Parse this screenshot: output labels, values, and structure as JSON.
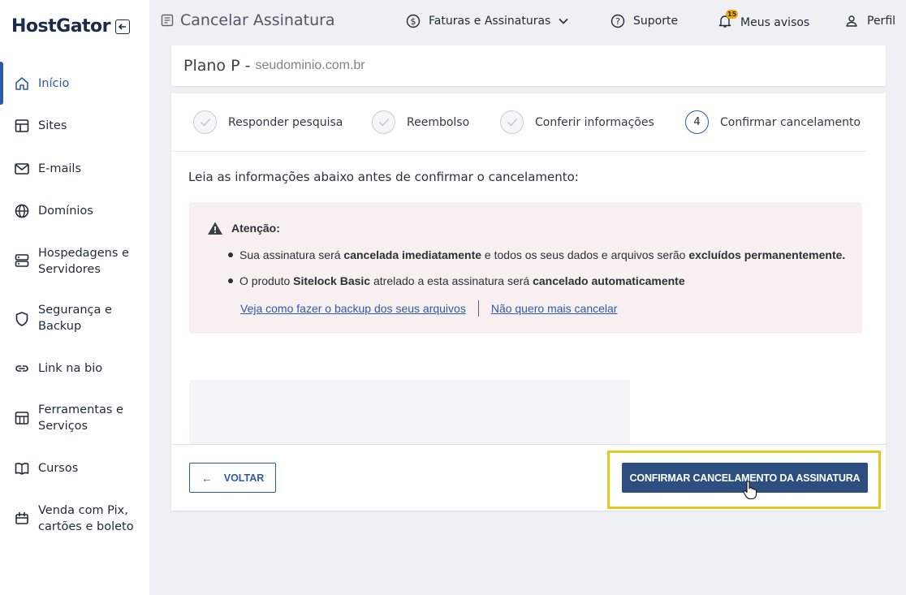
{
  "brand": {
    "logo_text": "HostGator",
    "accent": "#2e5aa8",
    "highlight": "#e8c81e"
  },
  "sidebar": {
    "items": [
      {
        "label": "Início",
        "icon": "home-icon",
        "active": true
      },
      {
        "label": "Sites",
        "icon": "sites-icon"
      },
      {
        "label": "E-mails",
        "icon": "mail-icon"
      },
      {
        "label": "Domínios",
        "icon": "globe-icon"
      },
      {
        "label": "Hospedagens e Servidores",
        "icon": "server-icon"
      },
      {
        "label": "Segurança e Backup",
        "icon": "shield-icon"
      },
      {
        "label": "Link na bio",
        "icon": "link-icon"
      },
      {
        "label": "Ferramentas e Serviços",
        "icon": "tools-icon"
      },
      {
        "label": "Cursos",
        "icon": "book-icon"
      },
      {
        "label": "Venda com Pix, cartões e boleto",
        "icon": "payment-icon"
      }
    ]
  },
  "topbar": {
    "title": "Cancelar Assinatura",
    "invoices_label": "Faturas e Assinaturas",
    "support_label": "Suporte",
    "notices_label": "Meus avisos",
    "notices_count": "15",
    "profile_label": "Perfil"
  },
  "plan": {
    "name": "Plano P -",
    "domain": "seudominio.com.br"
  },
  "steps": [
    {
      "label": "Responder pesquisa",
      "state": "done"
    },
    {
      "label": "Reembolso",
      "state": "done"
    },
    {
      "label": "Conferir informações",
      "state": "done"
    },
    {
      "label": "Confirmar cancelamento",
      "state": "current",
      "number": "4"
    }
  ],
  "content": {
    "intro": "Leia as informações abaixo antes de confirmar o cancelamento:",
    "alert_title": "Atenção:",
    "bullet1": {
      "pre": "Sua assinatura será ",
      "b1": "cancelada imediatamente",
      "mid": " e todos os seus dados e arquivos serão ",
      "b2": "excluídos permanentemente."
    },
    "bullet2": {
      "pre": "O produto ",
      "b1": "Sitelock Basic",
      "mid": " atrelado a esta assinatura será ",
      "b2": "cancelado automaticamente"
    },
    "link_backup": "Veja como fazer o backup dos seus arquivos",
    "link_keep": "Não quero mais cancelar"
  },
  "footer": {
    "back_label": "VOLTAR",
    "confirm_label": "CONFIRMAR CANCELAMENTO DA ASSINATURA"
  }
}
